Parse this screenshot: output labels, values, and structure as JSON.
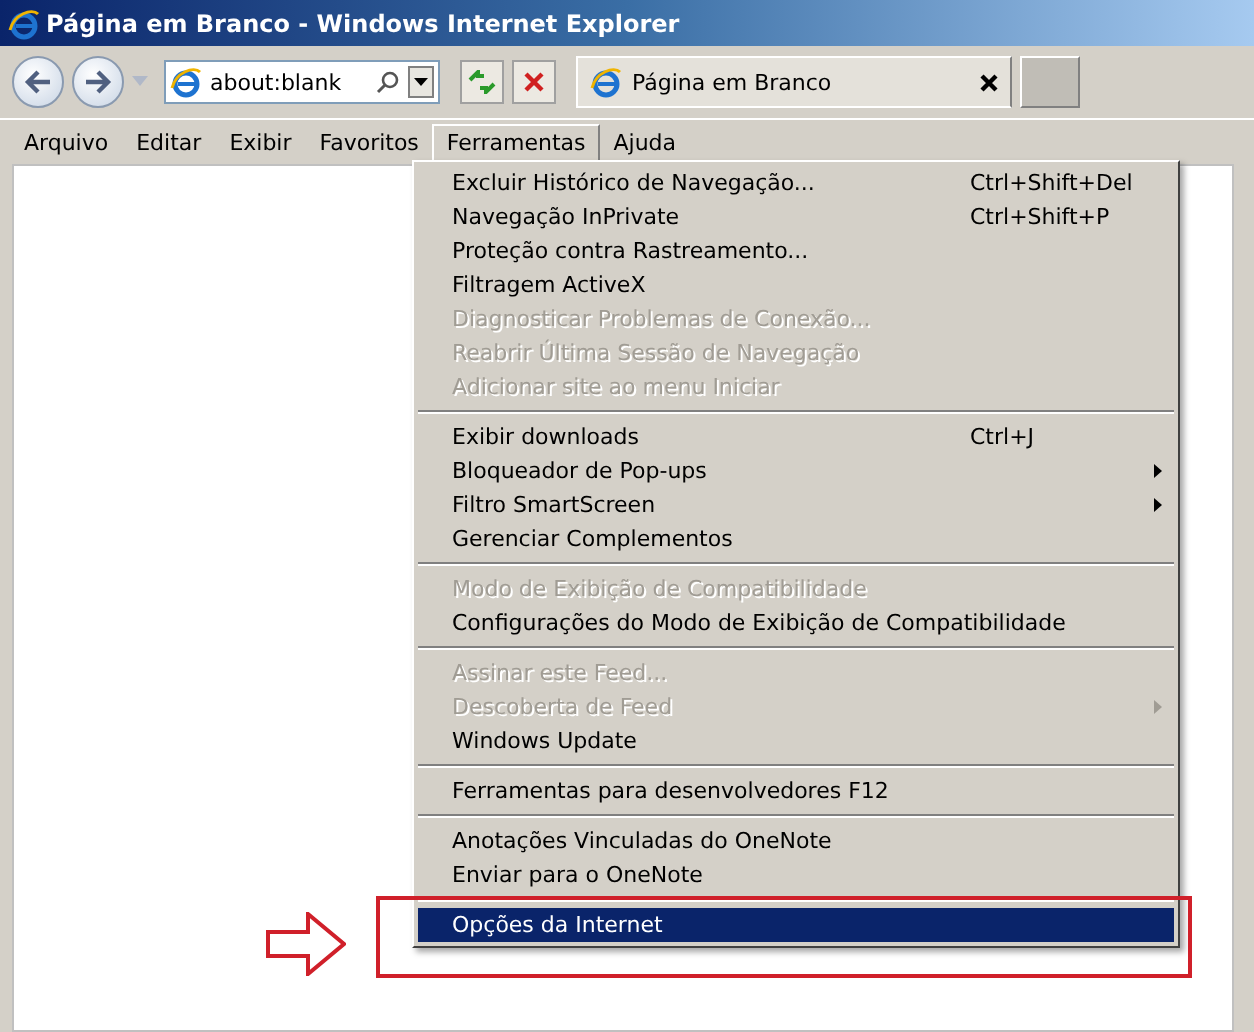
{
  "window": {
    "title": "Página em Branco - Windows Internet Explorer"
  },
  "address_bar": {
    "value": "about:blank"
  },
  "tabs": [
    {
      "label": "Página em Branco",
      "selected": true
    }
  ],
  "menu_bar": [
    {
      "label": "Arquivo",
      "selected": false
    },
    {
      "label": "Editar",
      "selected": false
    },
    {
      "label": "Exibir",
      "selected": false
    },
    {
      "label": "Favoritos",
      "selected": false
    },
    {
      "label": "Ferramentas",
      "selected": true
    },
    {
      "label": "Ajuda",
      "selected": false
    }
  ],
  "menu": [
    [
      {
        "label": "Excluir Histórico de Navegação...",
        "shortcut": "Ctrl+Shift+Del",
        "disabled": false,
        "submenu": false,
        "selected": false
      },
      {
        "label": "Navegação InPrivate",
        "shortcut": "Ctrl+Shift+P",
        "disabled": false,
        "submenu": false,
        "selected": false
      },
      {
        "label": "Proteção contra Rastreamento...",
        "disabled": false,
        "submenu": false,
        "selected": false
      },
      {
        "label": "Filtragem ActiveX",
        "disabled": false,
        "submenu": false,
        "selected": false
      },
      {
        "label": "Diagnosticar Problemas de Conexão...",
        "disabled": true,
        "submenu": false,
        "selected": false
      },
      {
        "label": "Reabrir Última Sessão de Navegação",
        "disabled": true,
        "submenu": false,
        "selected": false
      },
      {
        "label": "Adicionar site ao menu Iniciar",
        "disabled": true,
        "submenu": false,
        "selected": false
      }
    ],
    [
      {
        "label": "Exibir downloads",
        "shortcut": "Ctrl+J",
        "disabled": false,
        "submenu": false,
        "selected": false
      },
      {
        "label": "Bloqueador de Pop-ups",
        "disabled": false,
        "submenu": true,
        "selected": false
      },
      {
        "label": "Filtro SmartScreen",
        "disabled": false,
        "submenu": true,
        "selected": false
      },
      {
        "label": "Gerenciar Complementos",
        "disabled": false,
        "submenu": false,
        "selected": false
      }
    ],
    [
      {
        "label": "Modo de Exibição de Compatibilidade",
        "disabled": true,
        "submenu": false,
        "selected": false
      },
      {
        "label": "Configurações do Modo de Exibição de Compatibilidade",
        "disabled": false,
        "submenu": false,
        "selected": false
      }
    ],
    [
      {
        "label": "Assinar este Feed...",
        "disabled": true,
        "submenu": false,
        "selected": false
      },
      {
        "label": "Descoberta de Feed",
        "disabled": true,
        "submenu": true,
        "selected": false
      },
      {
        "label": "Windows Update",
        "disabled": false,
        "submenu": false,
        "selected": false
      }
    ],
    [
      {
        "label": "Ferramentas para desenvolvedores F12",
        "disabled": false,
        "submenu": false,
        "selected": false
      }
    ],
    [
      {
        "label": "Anotações Vinculadas do OneNote",
        "disabled": false,
        "submenu": false,
        "selected": false
      },
      {
        "label": "Enviar para o OneNote",
        "disabled": false,
        "submenu": false,
        "selected": false
      }
    ],
    [
      {
        "label": "Opções da Internet",
        "disabled": false,
        "submenu": false,
        "selected": true
      }
    ]
  ]
}
